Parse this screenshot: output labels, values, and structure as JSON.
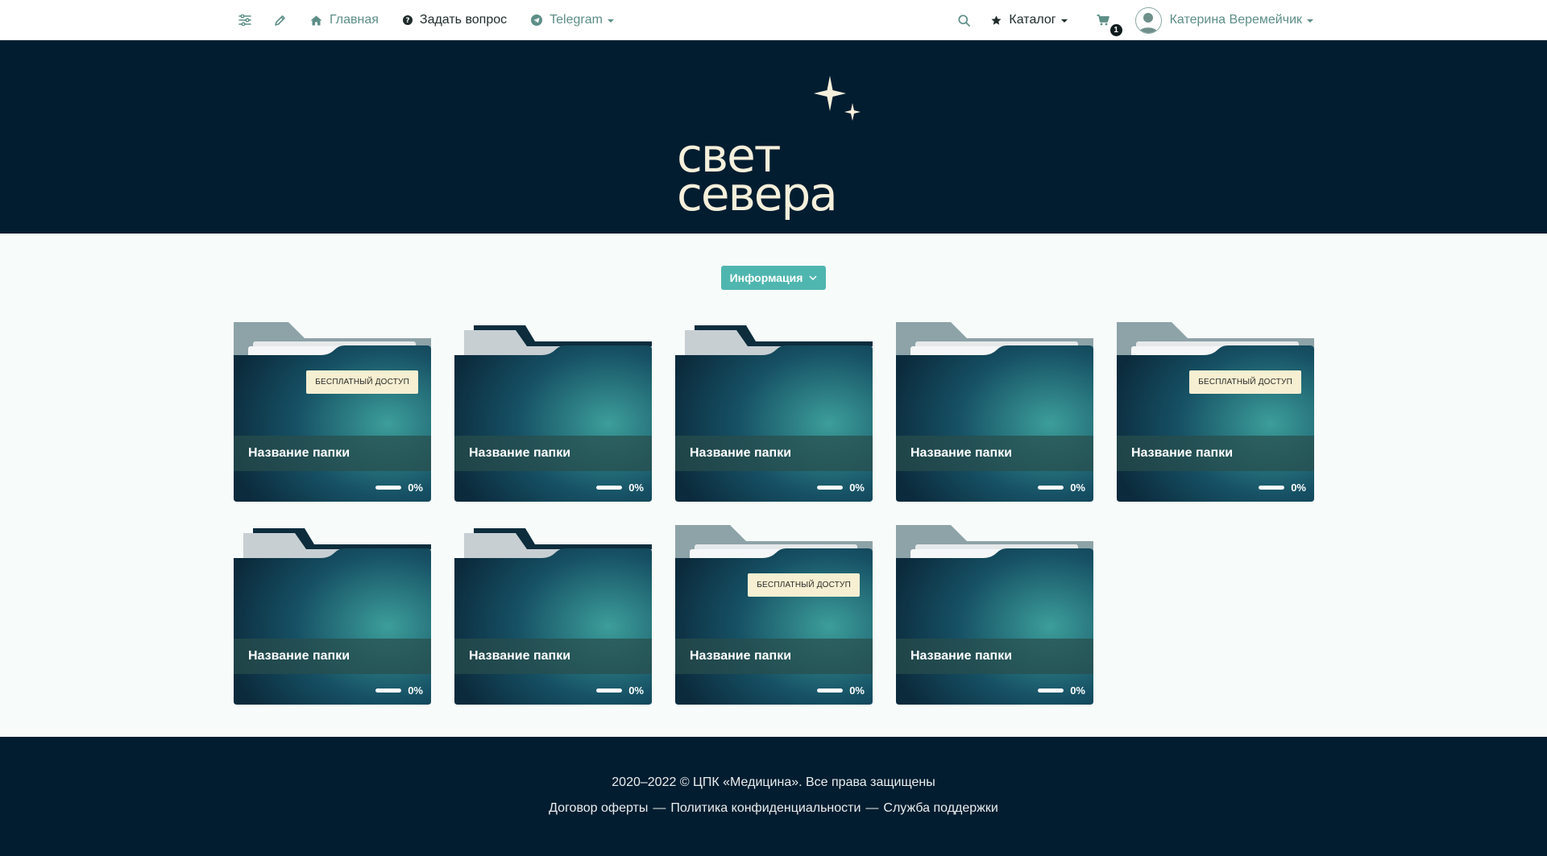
{
  "nav": {
    "home_label": "Главная",
    "ask_label": "Задать вопрос",
    "telegram_label": "Telegram",
    "catalog_label": "Каталог",
    "cart_count": "1",
    "user_name": "Катерина Веремейчик",
    "icons": [
      "sliders-icon",
      "pencil-icon",
      "home-icon",
      "question-circle-icon",
      "telegram-icon",
      "search-icon",
      "star-icon",
      "cart-icon",
      "user-avatar-icon"
    ]
  },
  "hero": {
    "logo_line1": "свет",
    "logo_line2": "севера"
  },
  "info_button": {
    "label": "Информация"
  },
  "cards": [
    {
      "title": "Название папки",
      "badge": "БЕСПЛАТНЫЙ ДОСТУП",
      "progress_text": "0%",
      "progress": 0,
      "variant": "open"
    },
    {
      "title": "Название папки",
      "badge": "",
      "progress_text": "0%",
      "progress": 0,
      "variant": "closed"
    },
    {
      "title": "Название папки",
      "badge": "",
      "progress_text": "0%",
      "progress": 0,
      "variant": "closed"
    },
    {
      "title": "Название папки",
      "badge": "",
      "progress_text": "0%",
      "progress": 0,
      "variant": "open"
    },
    {
      "title": "Название папки",
      "badge": "БЕСПЛАТНЫЙ ДОСТУП",
      "progress_text": "0%",
      "progress": 0,
      "variant": "open"
    },
    {
      "title": "Название папки",
      "badge": "",
      "progress_text": "0%",
      "progress": 0,
      "variant": "closed"
    },
    {
      "title": "Название папки",
      "badge": "",
      "progress_text": "0%",
      "progress": 0,
      "variant": "closed"
    },
    {
      "title": "Название папки",
      "badge": "БЕСПЛАТНЫЙ ДОСТУП",
      "progress_text": "0%",
      "progress": 0,
      "variant": "open"
    },
    {
      "title": "Название папки",
      "badge": "",
      "progress_text": "0%",
      "progress": 0,
      "variant": "open"
    }
  ],
  "footer": {
    "copyright": "2020–2022 © ЦПК «Медицина». Все права защищены",
    "links": [
      "Договор оферты",
      "Политика конфиденциальности",
      "Служба поддержки"
    ],
    "separator": "—"
  },
  "colors": {
    "hero_bg": "#031d30",
    "accent": "#4fb6af",
    "nav_teal": "#5c8e87",
    "badge_bg": "#f6efd2"
  }
}
